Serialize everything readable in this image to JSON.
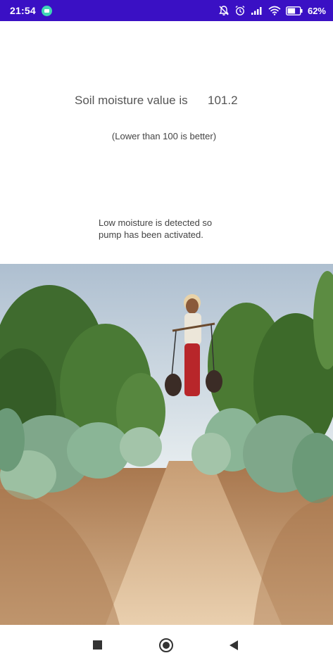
{
  "status_bar": {
    "time": "21:54",
    "battery_percent": "62%",
    "icons": [
      "app-notification-icon",
      "notifications-off-icon",
      "alarm-icon",
      "signal-icon",
      "wifi-icon",
      "battery-icon"
    ],
    "background_color": "#3a10c4"
  },
  "main": {
    "moisture_label": "Soil moisture value is",
    "moisture_value": "101.2",
    "hint": "(Lower than 100 is better)",
    "status_message_line1": "Low moisture is detected so",
    "status_message_line2": "pump has been activated."
  },
  "nav_bar": {
    "icons": [
      "recents-icon",
      "home-icon",
      "back-icon"
    ]
  }
}
